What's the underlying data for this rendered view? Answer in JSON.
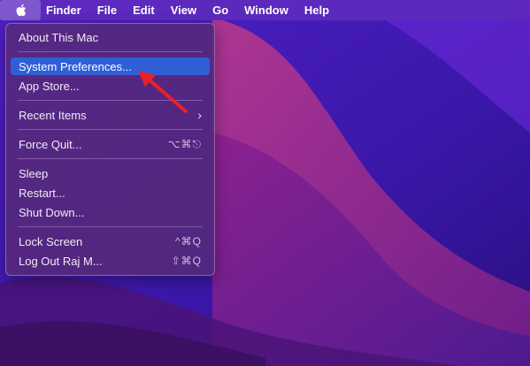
{
  "menubar": {
    "items": [
      "Finder",
      "File",
      "Edit",
      "View",
      "Go",
      "Window",
      "Help"
    ]
  },
  "apple_menu": {
    "about": "About This Mac",
    "system_preferences": "System Preferences...",
    "app_store": "App Store...",
    "recent_items": "Recent Items",
    "force_quit": "Force Quit...",
    "force_quit_shortcut": "⌥⌘⎋",
    "sleep": "Sleep",
    "restart": "Restart...",
    "shut_down": "Shut Down...",
    "lock_screen": "Lock Screen",
    "lock_screen_shortcut": "^⌘Q",
    "log_out": "Log Out Raj M...",
    "log_out_shortcut": "⇧⌘Q"
  },
  "colors": {
    "highlight": "#2f5fd6",
    "arrow": "#e8202a"
  }
}
